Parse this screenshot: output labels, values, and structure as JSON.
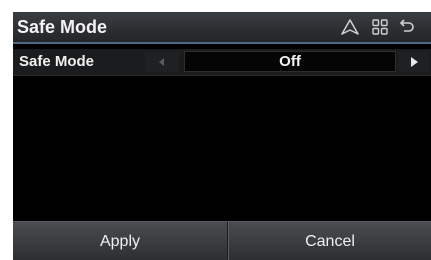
{
  "header": {
    "title": "Safe Mode",
    "icons": [
      "navigation-icon",
      "apps-grid-icon",
      "back-icon"
    ]
  },
  "setting": {
    "label": "Safe Mode",
    "value": "Off",
    "prev_icon": "left-arrow-icon",
    "next_icon": "right-arrow-icon"
  },
  "footer": {
    "apply_label": "Apply",
    "cancel_label": "Cancel"
  },
  "colors": {
    "background": "#000000",
    "header": "#2e3034",
    "header_accent": "#4a6a86",
    "text": "#f0f0f0"
  }
}
